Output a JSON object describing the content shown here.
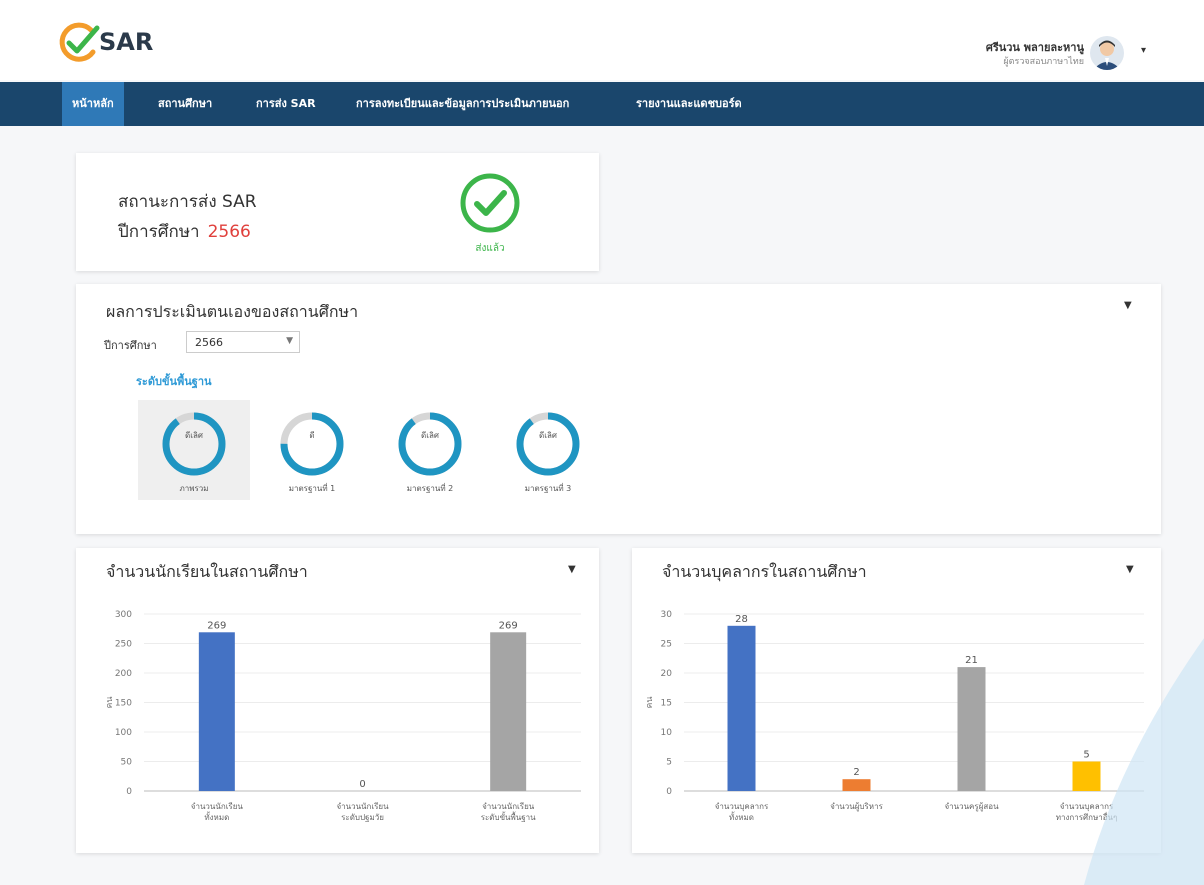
{
  "brand": {
    "logo_text": "SAR",
    "accent": "#1a466c",
    "active_nav": "#2f79b7"
  },
  "user": {
    "name": "ศรีนวน พลายละหานู",
    "role": "ผู้ตรวจสอบภาษาไทย"
  },
  "nav": {
    "items": [
      {
        "label": "หน้าหลัก",
        "active": true
      },
      {
        "label": "สถานศึกษา",
        "active": false
      },
      {
        "label": "การส่ง SAR",
        "active": false
      },
      {
        "label": "การลงทะเบียนและข้อมูลการประเมินภายนอก",
        "active": false
      },
      {
        "label": "รายงานและแดชบอร์ด",
        "active": false
      }
    ]
  },
  "status_card": {
    "status_label": "สถานะการส่ง SAR",
    "year_label": "ปีการศึกษา",
    "year_value": "2566",
    "check_caption": "ส่งแล้ว",
    "check_color": "#3cb54a"
  },
  "assessment": {
    "title": "ผลการประเมินตนเองของสถานศึกษา",
    "year_label": "ปีการศึกษา",
    "year_value": "2566",
    "level_title": "ระดับขั้นพื้นฐาน",
    "donuts": [
      {
        "center": "ดีเลิศ",
        "label": "ภาพรวม",
        "fill": 0.9,
        "active": true
      },
      {
        "center": "ดี",
        "label": "มาตรฐานที่ 1",
        "fill": 0.75,
        "active": false
      },
      {
        "center": "ดีเลิศ",
        "label": "มาตรฐานที่ 2",
        "fill": 0.9,
        "active": false
      },
      {
        "center": "ดีเลิศ",
        "label": "มาตรฐานที่ 3",
        "fill": 0.9,
        "active": false
      }
    ]
  },
  "chart_data": [
    {
      "type": "bar",
      "title": "จำนวนนักเรียนในสถานศึกษา",
      "ylabel": "คน",
      "ylim": [
        0,
        300
      ],
      "yticks": [
        0,
        50,
        100,
        150,
        200,
        250,
        300
      ],
      "categories": [
        [
          "จำนวนนักเรียน",
          "ทั้งหมด"
        ],
        [
          "จำนวนนักเรียน",
          "ระดับปฐมวัย"
        ],
        [
          "จำนวนนักเรียน",
          "ระดับขั้นพื้นฐาน"
        ]
      ],
      "values": [
        269,
        0,
        269
      ],
      "colors": [
        "#4472c4",
        "#ed7d31",
        "#a5a5a5"
      ],
      "grid": true
    },
    {
      "type": "bar",
      "title": "จำนวนบุคลากรในสถานศึกษา",
      "ylabel": "คน",
      "ylim": [
        0,
        30
      ],
      "yticks": [
        0,
        5,
        10,
        15,
        20,
        25,
        30
      ],
      "categories": [
        [
          "จำนวนบุคลากร",
          "ทั้งหมด"
        ],
        [
          "จำนวนผู้บริหาร"
        ],
        [
          "จำนวนครูผู้สอน"
        ],
        [
          "จำนวนบุคลากร",
          "ทางการศึกษาอื่นๆ"
        ]
      ],
      "values": [
        28,
        2,
        21,
        5
      ],
      "colors": [
        "#4472c4",
        "#ed7d31",
        "#a5a5a5",
        "#ffc000"
      ],
      "grid": true
    }
  ]
}
